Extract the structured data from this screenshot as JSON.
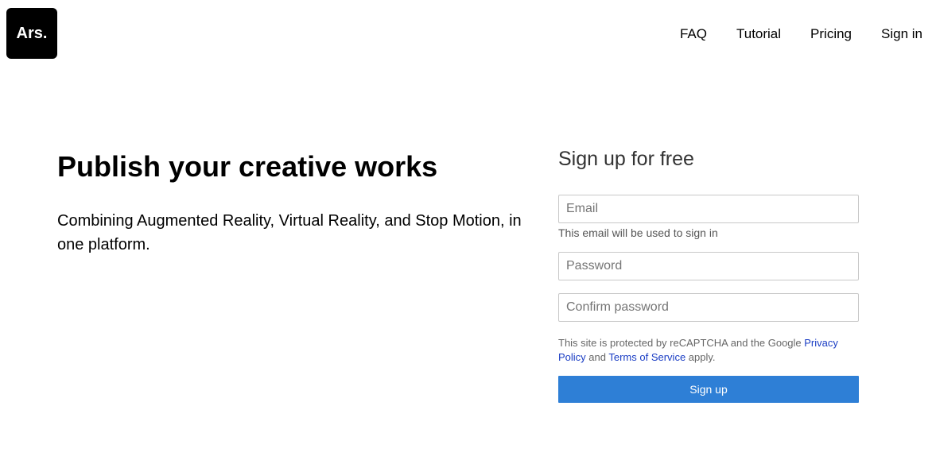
{
  "header": {
    "logo_text": "Ars.",
    "nav": [
      {
        "label": "FAQ"
      },
      {
        "label": "Tutorial"
      },
      {
        "label": "Pricing"
      },
      {
        "label": "Sign in"
      }
    ]
  },
  "hero": {
    "title": "Publish your creative works",
    "subtitle": "Combining Augmented Reality, Virtual Reality, and Stop Motion, in one platform."
  },
  "signup_form": {
    "title": "Sign up for free",
    "email_placeholder": "Email",
    "email_hint": "This email will be used to sign in",
    "password_placeholder": "Password",
    "confirm_placeholder": "Confirm password",
    "recaptcha": {
      "text_before": "This site is protected by reCAPTCHA and the Google ",
      "privacy_link": "Privacy Policy",
      "text_middle": " and ",
      "terms_link": "Terms of Service",
      "text_after": " apply."
    },
    "submit_label": "Sign up",
    "submit_color": "#2e7fd6"
  }
}
